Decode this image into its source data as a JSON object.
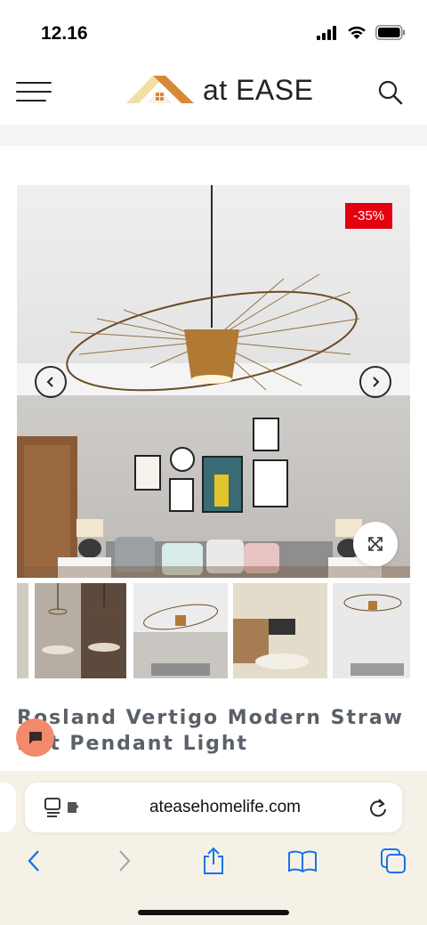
{
  "status_bar": {
    "time": "12.16"
  },
  "header": {
    "logo_text": "at EASE",
    "logo_icon": "house-roof-logo",
    "menu_icon": "hamburger-menu-icon",
    "search_icon": "search-icon"
  },
  "product": {
    "discount_badge": "-35%",
    "title_line1": "Rosland Vertigo Modern Straw",
    "title_line2": "Hat Pendant Light"
  },
  "gallery": {
    "thumbnails": [
      "dining-room-thumbnail",
      "living-room-thumbnail",
      "bright-living-thumbnail",
      "side-living-thumbnail"
    ]
  },
  "browser": {
    "url": "ateasehomelife.com"
  },
  "colors": {
    "badge": "#e3000f",
    "chat": "#f28b6d",
    "logo_orange": "#d7893a",
    "browser_tint": "#f6f1e7",
    "toolbar_blue": "#1a73e8"
  }
}
